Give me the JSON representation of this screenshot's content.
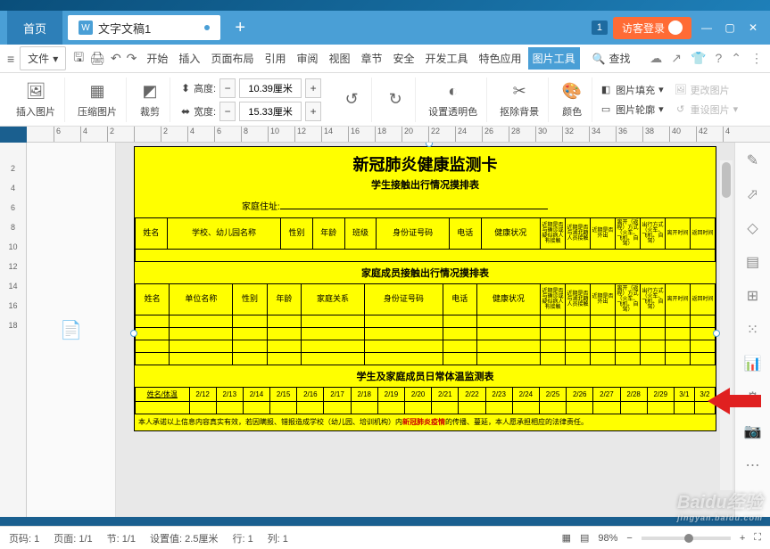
{
  "tabs": {
    "home": "首页",
    "doc": "文字文稿1",
    "badge": "1",
    "login": "访客登录"
  },
  "menu": {
    "file": "文件",
    "items": [
      "开始",
      "插入",
      "页面布局",
      "引用",
      "审阅",
      "视图",
      "章节",
      "安全",
      "开发工具",
      "特色应用",
      "图片工具"
    ],
    "search": "查找"
  },
  "ribbon": {
    "insert_pic": "插入图片",
    "compress": "压缩图片",
    "crop": "裁剪",
    "height_label": "高度:",
    "height_val": "10.39厘米",
    "width_label": "宽度:",
    "width_val": "15.33厘米",
    "transparent": "设置透明色",
    "remove_bg": "抠除背景",
    "color": "颜色",
    "fill": "图片填充",
    "outline": "图片轮廓",
    "change": "更改图片",
    "reset": "重设图片"
  },
  "doc": {
    "title": "新冠肺炎健康监测卡",
    "subtitle1": "学生接触出行情况摸排表",
    "addr_label": "家庭住址:",
    "headers1": [
      "姓名",
      "学校、幼儿园名称",
      "性别",
      "年龄",
      "班级",
      "身份证号码",
      "电话",
      "健康状况"
    ],
    "headers_ext": [
      "近期是否与确诊或疑似病人有接触",
      "近期是否与湖北籍人员接触",
      "近期是否外出",
      "离开（返程）方式（火车、飞机、自驾）",
      "出行方式（火车、飞机、自驾）",
      "离开时间",
      "返回时间"
    ],
    "section2": "家庭成员接触出行情况摸排表",
    "headers2": [
      "姓名",
      "单位名称",
      "性别",
      "年龄",
      "家庭关系",
      "身份证号码",
      "电话",
      "健康状况"
    ],
    "section3": "学生及家庭成员日常体温监测表",
    "date_hdr": "姓名/体温",
    "dates": [
      "2/12",
      "2/13",
      "2/14",
      "2/15",
      "2/16",
      "2/17",
      "2/18",
      "2/19",
      "2/20",
      "2/21",
      "2/22",
      "2/23",
      "2/24",
      "2/25",
      "2/26",
      "2/27",
      "2/28",
      "2/29",
      "3/1",
      "3/2"
    ],
    "footnote_pre": "本人承诺以上信息内容真实有效，若因瞒报、错报造成学校（幼儿园、培训机构）内",
    "footnote_red": "新冠肺炎疫情",
    "footnote_post": "的传播、蔓延，本人愿承担相应的法律责任。"
  },
  "status": {
    "page": "页码: 1",
    "page_no": "页面: 1/1",
    "section": "节: 1/1",
    "setting": "设置值: 2.5厘米",
    "row": "行: 1",
    "col": "列: 1",
    "zoom": "98%"
  },
  "ruler_h": [
    "6",
    "4",
    "2",
    "",
    "2",
    "4",
    "6",
    "8",
    "10",
    "12",
    "14",
    "16",
    "18",
    "20",
    "22",
    "24",
    "26",
    "28",
    "30",
    "32",
    "34",
    "36",
    "38",
    "40",
    "42",
    "4"
  ],
  "ruler_v": [
    "",
    "2",
    "4",
    "6",
    "8",
    "10",
    "12",
    "14",
    "16",
    "18"
  ],
  "watermark": {
    "main": "Baidu经验",
    "sub": "jingyan.baidu.com"
  }
}
